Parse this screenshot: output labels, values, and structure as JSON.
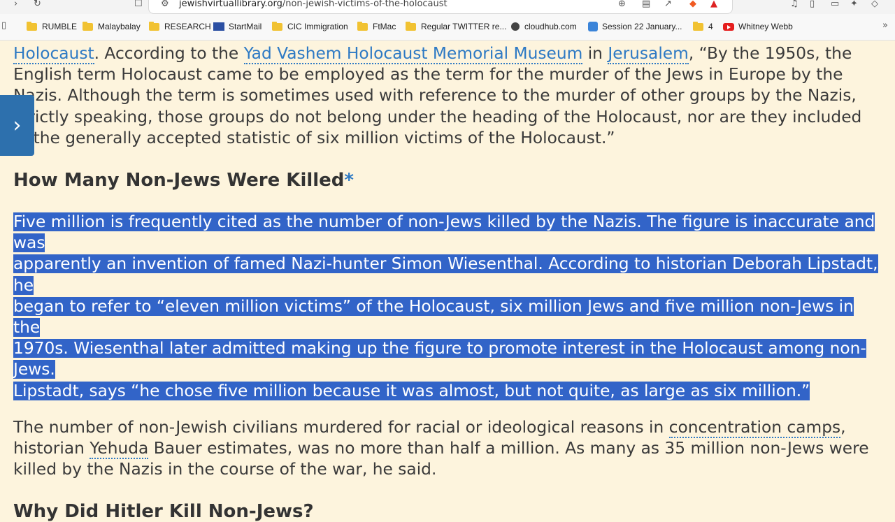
{
  "browser": {
    "url_domain": "jewishvirtuallibrary.org",
    "url_path": "/non-jewish-victims-of-the-holocaust"
  },
  "bookmarks": [
    {
      "label": "RUMBLE",
      "icon": "folder-icon"
    },
    {
      "label": "Malaybalay",
      "icon": "folder-icon"
    },
    {
      "label": "RESEARCH",
      "icon": "folder-icon"
    },
    {
      "label": "StartMail",
      "icon": "mail-icon"
    },
    {
      "label": "CIC Immigration",
      "icon": "folder-icon"
    },
    {
      "label": "FtMac",
      "icon": "folder-icon"
    },
    {
      "label": "Regular TWITTER re...",
      "icon": "folder-icon"
    },
    {
      "label": "cloudhub.com",
      "icon": "globe-icon"
    },
    {
      "label": "Session 22 January...",
      "icon": "session-icon"
    },
    {
      "label": "4",
      "icon": "folder-icon"
    },
    {
      "label": "Whitney Webb",
      "icon": "youtube-icon"
    }
  ],
  "article": {
    "p1": {
      "link_holocaust": "Holocaust",
      "t1": ".  According to the ",
      "link_yad": "Yad Vashem Holocaust Memorial Museum",
      "t2": " in ",
      "link_jerusalem": "Jerusalem",
      "t3": ", “By the 1950s, the English term Holocaust came to be employed as the term for the murder of the Jews in Europe by the Nazis. Although the term is sometimes used with reference to the murder of other groups by the Nazis, strictly speaking, those groups do not belong under the heading of the Holocaust, nor are they included in the generally accepted statistic of six million victims of the Holocaust.”"
    },
    "h2a": "How Many Non-Jews Were Killed",
    "h2a_marker": "*",
    "p2_lines": [
      "Five million is frequently cited as the number of non-Jews killed by the Nazis. The figure is inaccurate and was",
      "apparently an invention of famed Nazi-hunter Simon Wiesenthal. According to historian Deborah Lipstadt, he",
      "began to refer to “eleven million victims” of the Holocaust, six million Jews and five million non-Jews in the",
      "1970s. Wiesenthal later admitted making up the figure to promote interest in the Holocaust among non-Jews.",
      "Lipstadt, says “he chose five million because it was almost, but not quite, as large as six million.”"
    ],
    "p3": {
      "t1": "The number of non-Jewish civilians murdered for racial or ideological reasons in ",
      "link_camps": "concentration camps",
      "t2": ", historian ",
      "link_yehuda": "Yehuda",
      "t3": " Bauer estimates, was no more than half a million. As many as 35 million non-Jews were killed by the Nazis in the course of the war, he said."
    },
    "h2b": "Why Did Hitler Kill Non-Jews?"
  }
}
